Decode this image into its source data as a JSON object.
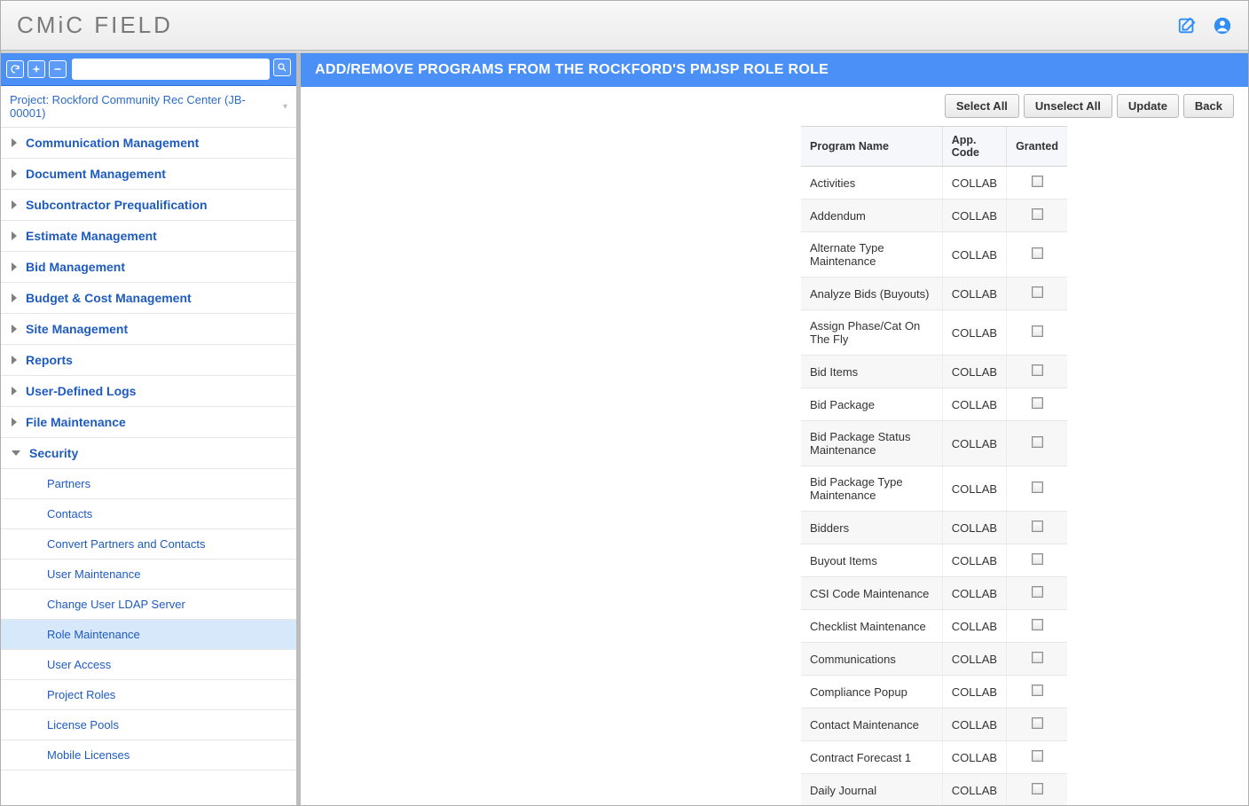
{
  "brand": {
    "prefix": "CM",
    "mid": "i",
    "suffix": "C",
    "word": "FIELD"
  },
  "project": {
    "label": "Project: Rockford Community Rec Center (JB-00001)"
  },
  "sidebar": {
    "groups": [
      {
        "label": "Communication Management",
        "expanded": false
      },
      {
        "label": "Document Management",
        "expanded": false
      },
      {
        "label": "Subcontractor Prequalification",
        "expanded": false
      },
      {
        "label": "Estimate Management",
        "expanded": false
      },
      {
        "label": "Bid Management",
        "expanded": false
      },
      {
        "label": "Budget & Cost Management",
        "expanded": false
      },
      {
        "label": "Site Management",
        "expanded": false
      },
      {
        "label": "Reports",
        "expanded": false
      },
      {
        "label": "User-Defined Logs",
        "expanded": false
      },
      {
        "label": "File Maintenance",
        "expanded": false
      },
      {
        "label": "Security",
        "expanded": true,
        "items": [
          {
            "label": "Partners",
            "selected": false
          },
          {
            "label": "Contacts",
            "selected": false
          },
          {
            "label": "Convert Partners and Contacts",
            "selected": false
          },
          {
            "label": "User Maintenance",
            "selected": false
          },
          {
            "label": "Change User LDAP Server",
            "selected": false
          },
          {
            "label": "Role Maintenance",
            "selected": true
          },
          {
            "label": "User Access",
            "selected": false
          },
          {
            "label": "Project Roles",
            "selected": false
          },
          {
            "label": "License Pools",
            "selected": false
          },
          {
            "label": "Mobile Licenses",
            "selected": false
          }
        ]
      }
    ]
  },
  "page": {
    "title": "ADD/REMOVE PROGRAMS FROM THE ROCKFORD'S PMJSP ROLE ROLE",
    "actions": {
      "select_all": "Select All",
      "unselect_all": "Unselect All",
      "update": "Update",
      "back": "Back"
    }
  },
  "table": {
    "headers": {
      "program": "Program Name",
      "app_code": "App. Code",
      "granted": "Granted"
    },
    "rows": [
      {
        "program": "Activities",
        "app_code": "COLLAB",
        "granted": false
      },
      {
        "program": "Addendum",
        "app_code": "COLLAB",
        "granted": false
      },
      {
        "program": "Alternate Type Maintenance",
        "app_code": "COLLAB",
        "granted": false
      },
      {
        "program": "Analyze Bids (Buyouts)",
        "app_code": "COLLAB",
        "granted": false
      },
      {
        "program": "Assign Phase/Cat On The Fly",
        "app_code": "COLLAB",
        "granted": false
      },
      {
        "program": "Bid Items",
        "app_code": "COLLAB",
        "granted": false
      },
      {
        "program": "Bid Package",
        "app_code": "COLLAB",
        "granted": false
      },
      {
        "program": "Bid Package Status Maintenance",
        "app_code": "COLLAB",
        "granted": false
      },
      {
        "program": "Bid Package Type Maintenance",
        "app_code": "COLLAB",
        "granted": false
      },
      {
        "program": "Bidders",
        "app_code": "COLLAB",
        "granted": false
      },
      {
        "program": "Buyout Items",
        "app_code": "COLLAB",
        "granted": false
      },
      {
        "program": "CSI Code Maintenance",
        "app_code": "COLLAB",
        "granted": false
      },
      {
        "program": "Checklist Maintenance",
        "app_code": "COLLAB",
        "granted": false
      },
      {
        "program": "Communications",
        "app_code": "COLLAB",
        "granted": false
      },
      {
        "program": "Compliance Popup",
        "app_code": "COLLAB",
        "granted": false
      },
      {
        "program": "Contact Maintenance",
        "app_code": "COLLAB",
        "granted": false
      },
      {
        "program": "Contract Forecast 1",
        "app_code": "COLLAB",
        "granted": false
      },
      {
        "program": "Daily Journal",
        "app_code": "COLLAB",
        "granted": false
      }
    ]
  }
}
